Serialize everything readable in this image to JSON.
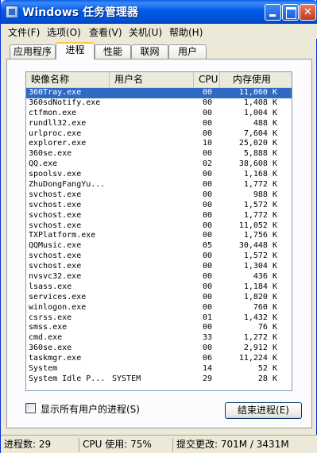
{
  "window": {
    "title": "Windows 任务管理器"
  },
  "menu": [
    "文件(F)",
    "选项(O)",
    "查看(V)",
    "关机(U)",
    "帮助(H)"
  ],
  "tabs": [
    {
      "label": "应用程序"
    },
    {
      "label": "进程",
      "active": true
    },
    {
      "label": "性能"
    },
    {
      "label": "联网"
    },
    {
      "label": "用户"
    }
  ],
  "table": {
    "columns": {
      "name": "映像名称",
      "user": "用户名",
      "cpu": "CPU",
      "mem": "内存使用"
    },
    "rows": [
      {
        "name": "360Tray.exe",
        "user": "",
        "cpu": "00",
        "mem": "11,060 K",
        "selected": true
      },
      {
        "name": "360sdNotify.exe",
        "user": "",
        "cpu": "00",
        "mem": "1,408 K"
      },
      {
        "name": "ctfmon.exe",
        "user": "",
        "cpu": "00",
        "mem": "1,004 K"
      },
      {
        "name": "rundll32.exe",
        "user": "",
        "cpu": "00",
        "mem": "488 K"
      },
      {
        "name": "urlproc.exe",
        "user": "",
        "cpu": "00",
        "mem": "7,604 K"
      },
      {
        "name": "explorer.exe",
        "user": "",
        "cpu": "10",
        "mem": "25,020 K"
      },
      {
        "name": "360se.exe",
        "user": "",
        "cpu": "00",
        "mem": "5,888 K"
      },
      {
        "name": "QQ.exe",
        "user": "",
        "cpu": "02",
        "mem": "38,608 K"
      },
      {
        "name": "spoolsv.exe",
        "user": "",
        "cpu": "00",
        "mem": "1,168 K"
      },
      {
        "name": "ZhuDongFangYu...",
        "user": "",
        "cpu": "00",
        "mem": "1,772 K"
      },
      {
        "name": "svchost.exe",
        "user": "",
        "cpu": "00",
        "mem": "988 K"
      },
      {
        "name": "svchost.exe",
        "user": "",
        "cpu": "00",
        "mem": "1,572 K"
      },
      {
        "name": "svchost.exe",
        "user": "",
        "cpu": "00",
        "mem": "1,772 K"
      },
      {
        "name": "svchost.exe",
        "user": "",
        "cpu": "00",
        "mem": "11,052 K"
      },
      {
        "name": "TXPlatform.exe",
        "user": "",
        "cpu": "00",
        "mem": "1,756 K"
      },
      {
        "name": "QQMusic.exe",
        "user": "",
        "cpu": "05",
        "mem": "30,448 K"
      },
      {
        "name": "svchost.exe",
        "user": "",
        "cpu": "00",
        "mem": "1,572 K"
      },
      {
        "name": "svchost.exe",
        "user": "",
        "cpu": "00",
        "mem": "1,304 K"
      },
      {
        "name": "nvsvc32.exe",
        "user": "",
        "cpu": "00",
        "mem": "436 K"
      },
      {
        "name": "lsass.exe",
        "user": "",
        "cpu": "00",
        "mem": "1,184 K"
      },
      {
        "name": "services.exe",
        "user": "",
        "cpu": "00",
        "mem": "1,820 K"
      },
      {
        "name": "winlogon.exe",
        "user": "",
        "cpu": "00",
        "mem": "760 K"
      },
      {
        "name": "csrss.exe",
        "user": "",
        "cpu": "01",
        "mem": "1,432 K"
      },
      {
        "name": "smss.exe",
        "user": "",
        "cpu": "00",
        "mem": "76 K"
      },
      {
        "name": "cmd.exe",
        "user": "",
        "cpu": "33",
        "mem": "1,272 K"
      },
      {
        "name": "360se.exe",
        "user": "",
        "cpu": "00",
        "mem": "2,912 K"
      },
      {
        "name": "taskmgr.exe",
        "user": "",
        "cpu": "06",
        "mem": "11,224 K"
      },
      {
        "name": "System",
        "user": "",
        "cpu": "14",
        "mem": "52 K"
      },
      {
        "name": "System Idle P...",
        "user": "SYSTEM",
        "cpu": "29",
        "mem": "28 K"
      }
    ]
  },
  "show_all_label": "显示所有用户的进程(S)",
  "show_all_checked": false,
  "end_button": "结束进程(E)",
  "status": {
    "processes": "进程数: 29",
    "cpu": "CPU 使用: 75%",
    "commit": "提交更改: 701M / 3431M"
  }
}
